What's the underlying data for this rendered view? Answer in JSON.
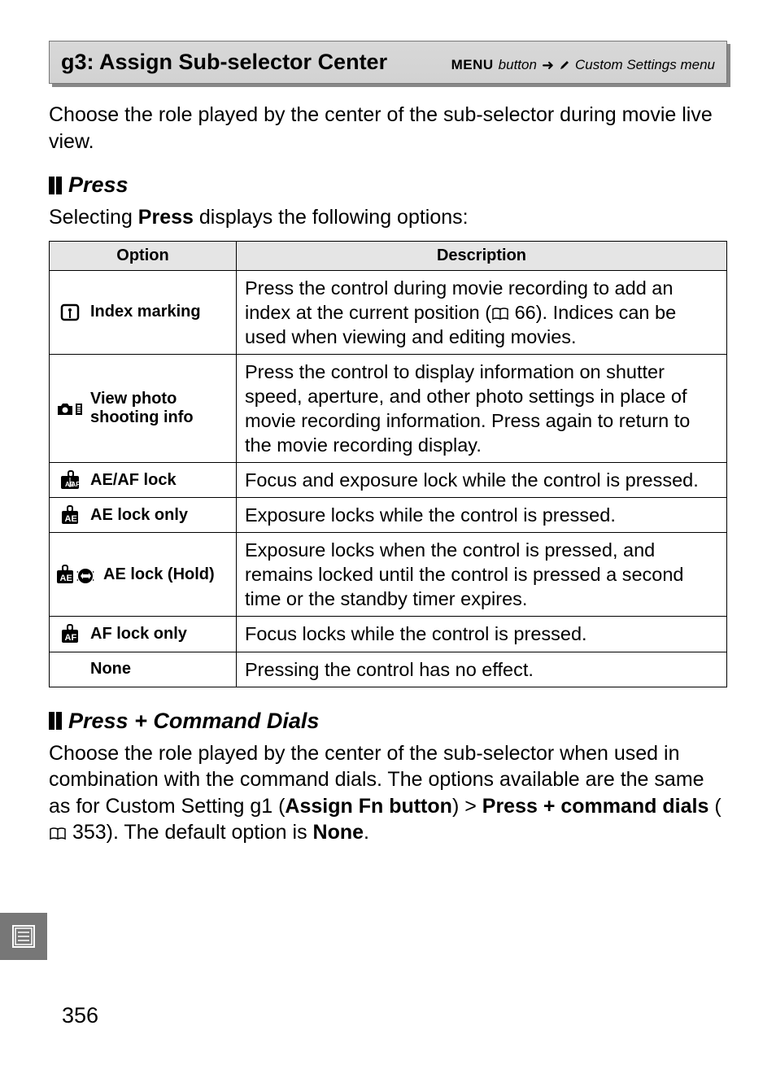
{
  "header": {
    "title": "g3: Assign Sub-selector Center",
    "menu_label": "MENU",
    "button_word": "button",
    "target": "Custom Settings menu"
  },
  "intro": "Choose the role played by the center of the sub-selector during movie live view.",
  "section1": {
    "title": "Press",
    "intro_a": "Selecting ",
    "intro_b": "Press",
    "intro_c": " displays the following options:"
  },
  "table1": {
    "headers": {
      "option": "Option",
      "description": "Description"
    },
    "rows": [
      {
        "option": "Index marking",
        "desc_a": "Press the control during movie recording to add an index at the current position (",
        "desc_ref": "66",
        "desc_b": ").  Indices can be used when viewing and editing movies."
      },
      {
        "option": "View photo shooting info",
        "desc": "Press the control to display information on shutter speed, aperture, and other photo settings in place of movie recording information.  Press again to return to the movie recording display."
      },
      {
        "option": "AE/AF lock",
        "desc": "Focus and exposure lock while the control is pressed."
      },
      {
        "option": "AE lock only",
        "desc": "Exposure locks while the control is pressed."
      },
      {
        "option": "AE lock (Hold)",
        "desc": "Exposure locks when the control is pressed, and remains locked until the control is pressed a second time or the standby timer expires."
      },
      {
        "option": "AF lock only",
        "desc": "Focus locks while the control is pressed."
      },
      {
        "option": "None",
        "desc": "Pressing the control has no effect."
      }
    ]
  },
  "section2": {
    "title": "Press + Command Dials",
    "text_a": "Choose the role played by the center of the sub-selector when used in combination with the command dials.  The options available are the same as for Custom Setting g1 (",
    "text_b": "Assign Fn button",
    "text_c": ") > ",
    "text_d": "Press + command dials",
    "text_e": " (",
    "text_ref": "353",
    "text_f": ").  The default option is ",
    "text_g": "None",
    "text_h": "."
  },
  "page_number": "356"
}
